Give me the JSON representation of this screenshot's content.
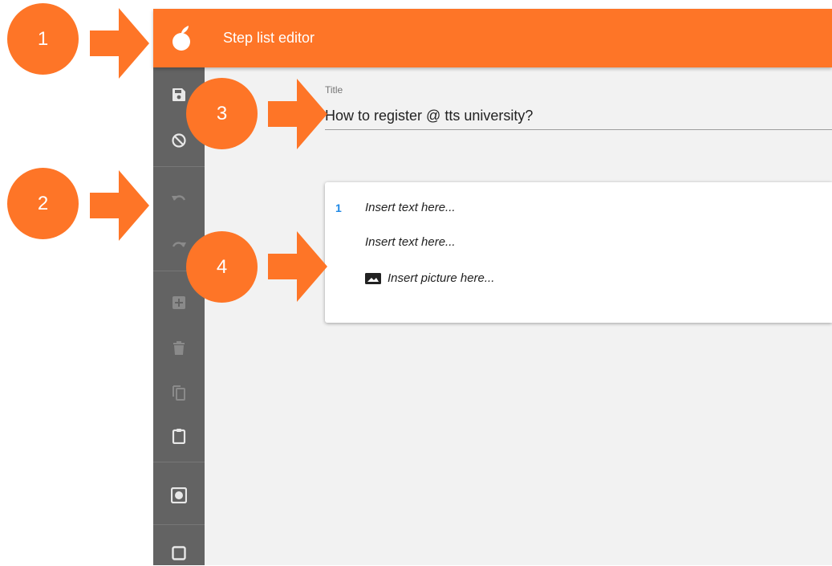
{
  "app": {
    "title": "Step list editor",
    "accent_color": "#fe7527",
    "sidebar_color": "#636363",
    "background_color": "#f2f2f2"
  },
  "toolbar": [
    {
      "icon": "save-icon",
      "enabled": true
    },
    {
      "icon": "cancel-icon",
      "enabled": true
    },
    {
      "icon": "undo-icon",
      "enabled": false
    },
    {
      "icon": "redo-icon",
      "enabled": false
    },
    {
      "icon": "add-step-icon",
      "enabled": false
    },
    {
      "icon": "delete-icon",
      "enabled": false
    },
    {
      "icon": "copy-icon",
      "enabled": false
    },
    {
      "icon": "paste-icon",
      "enabled": true
    },
    {
      "icon": "record-icon",
      "enabled": true
    },
    {
      "icon": "checkbox-icon",
      "enabled": true
    }
  ],
  "title_field": {
    "label": "Title",
    "value": "How to register @ tts university?"
  },
  "step_card": {
    "step_number": "1",
    "text_placeholder_1": "Insert text here...",
    "text_placeholder_2": "Insert text here...",
    "picture_placeholder": "Insert picture here...",
    "step_number_color": "#1e88e5"
  },
  "callouts": [
    "1",
    "2",
    "3",
    "4"
  ]
}
